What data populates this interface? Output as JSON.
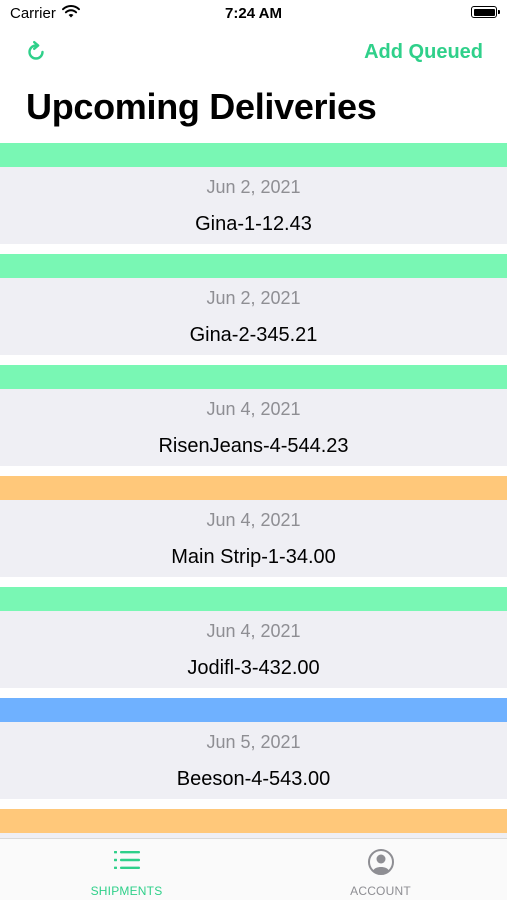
{
  "status_bar": {
    "carrier": "Carrier",
    "time": "7:24 AM"
  },
  "nav": {
    "refresh_icon": "refresh-icon",
    "add_queued_label": "Add Queued",
    "title": "Upcoming Deliveries"
  },
  "deliveries": [
    {
      "date": "Jun 2, 2021",
      "name": "Gina-1-12.43",
      "status_color": "#79f7b4"
    },
    {
      "date": "Jun 2, 2021",
      "name": "Gina-2-345.21",
      "status_color": "#79f7b4"
    },
    {
      "date": "Jun 4, 2021",
      "name": "RisenJeans-4-544.23",
      "status_color": "#79f7b4"
    },
    {
      "date": "Jun 4, 2021",
      "name": "Main Strip-1-34.00",
      "status_color": "#ffc87a"
    },
    {
      "date": "Jun 4, 2021",
      "name": "Jodifl-3-432.00",
      "status_color": "#79f7b4"
    },
    {
      "date": "Jun 5, 2021",
      "name": "Beeson-4-543.00",
      "status_color": "#6fb1ff"
    },
    {
      "date": "",
      "name": "",
      "status_color": "#ffc87a"
    }
  ],
  "tab_bar": {
    "tabs": [
      {
        "label": "SHIPMENTS",
        "icon": "list-icon",
        "selected": true
      },
      {
        "label": "ACCOUNT",
        "icon": "account-icon",
        "selected": false
      }
    ]
  },
  "colors": {
    "accent": "#2fd08a",
    "card_background": "#efeff4",
    "secondary_text": "#8e8e93"
  }
}
